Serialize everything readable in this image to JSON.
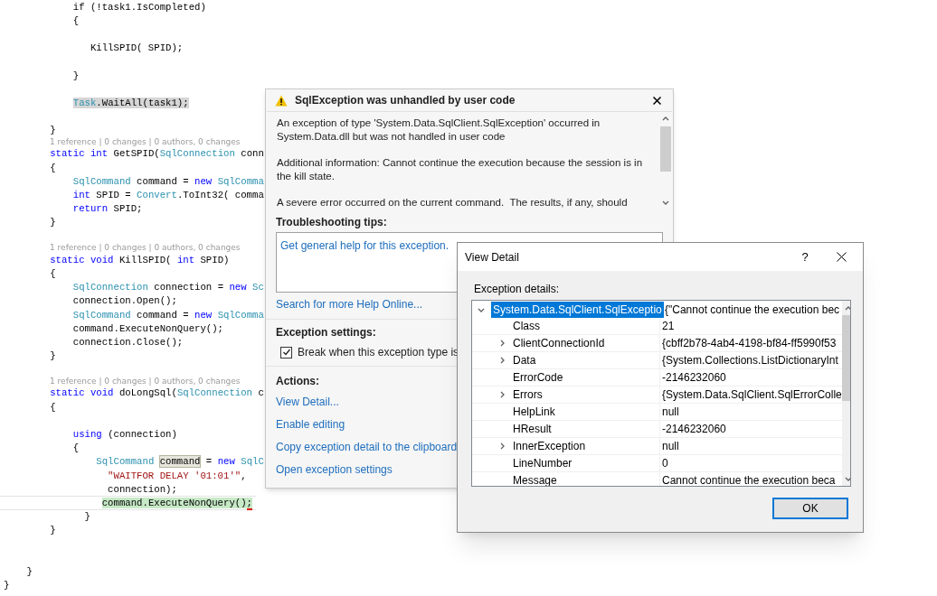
{
  "code_lines": [
    {
      "kind": "code",
      "tokens": [
        {
          "text": "            if (!task1.IsCompleted)",
          "kind": "plain"
        }
      ]
    },
    {
      "kind": "code",
      "tokens": [
        {
          "text": "            {",
          "kind": "plain"
        }
      ]
    },
    {
      "kind": "blank"
    },
    {
      "kind": "code",
      "tokens": [
        {
          "text": "               KillSPID( SPID);",
          "kind": "plain"
        }
      ]
    },
    {
      "kind": "blank"
    },
    {
      "kind": "code",
      "tokens": [
        {
          "text": "            }",
          "kind": "plain"
        }
      ]
    },
    {
      "kind": "blank"
    },
    {
      "kind": "code",
      "tokens": [
        {
          "text": "            Task",
          "kind": "type-gray"
        },
        {
          "text": ".WaitAll(task1);",
          "kind": "plain-gray"
        }
      ]
    },
    {
      "kind": "blank"
    },
    {
      "kind": "code",
      "tokens": [
        {
          "text": "        }",
          "kind": "plain"
        }
      ]
    },
    {
      "kind": "lens",
      "text": "1 reference | 0 changes | 0 authors, 0 changes"
    },
    {
      "kind": "code",
      "tokens": [
        {
          "text": "        static int ",
          "kind": "keyword"
        },
        {
          "text": "GetSPID(",
          "kind": "plain"
        },
        {
          "text": "SqlConnection",
          "kind": "type"
        },
        {
          "text": " conn",
          "kind": "plain"
        }
      ]
    },
    {
      "kind": "code",
      "tokens": [
        {
          "text": "        {",
          "kind": "plain"
        }
      ]
    },
    {
      "kind": "code",
      "tokens": [
        {
          "text": "            SqlCommand",
          "kind": "type"
        },
        {
          "text": " command = ",
          "kind": "plain"
        },
        {
          "text": "new ",
          "kind": "keyword"
        },
        {
          "text": "SqlComma",
          "kind": "type"
        }
      ]
    },
    {
      "kind": "code",
      "tokens": [
        {
          "text": "            int",
          "kind": "keyword"
        },
        {
          "text": " SPID = ",
          "kind": "plain"
        },
        {
          "text": "Convert",
          "kind": "type"
        },
        {
          "text": ".ToInt32( comma",
          "kind": "plain"
        }
      ]
    },
    {
      "kind": "code",
      "tokens": [
        {
          "text": "            return",
          "kind": "keyword"
        },
        {
          "text": " SPID;",
          "kind": "plain"
        }
      ]
    },
    {
      "kind": "code",
      "tokens": [
        {
          "text": "        }",
          "kind": "plain"
        }
      ]
    },
    {
      "kind": "blank"
    },
    {
      "kind": "lens",
      "text": "1 reference | 0 changes | 0 authors, 0 changes"
    },
    {
      "kind": "code",
      "tokens": [
        {
          "text": "        static void ",
          "kind": "keyword"
        },
        {
          "text": "KillSPID( ",
          "kind": "plain"
        },
        {
          "text": "int",
          "kind": "keyword"
        },
        {
          "text": " SPID)",
          "kind": "plain"
        }
      ]
    },
    {
      "kind": "code",
      "tokens": [
        {
          "text": "        {",
          "kind": "plain"
        }
      ]
    },
    {
      "kind": "code",
      "tokens": [
        {
          "text": "            SqlConnection",
          "kind": "type"
        },
        {
          "text": " connection = ",
          "kind": "plain"
        },
        {
          "text": "new ",
          "kind": "keyword"
        },
        {
          "text": "Sc",
          "kind": "type"
        }
      ]
    },
    {
      "kind": "code",
      "tokens": [
        {
          "text": "            connection.Open();",
          "kind": "plain"
        }
      ]
    },
    {
      "kind": "code",
      "tokens": [
        {
          "text": "            SqlCommand",
          "kind": "type"
        },
        {
          "text": " command = ",
          "kind": "plain"
        },
        {
          "text": "new ",
          "kind": "keyword"
        },
        {
          "text": "SqlComma",
          "kind": "type"
        }
      ]
    },
    {
      "kind": "code",
      "tokens": [
        {
          "text": "            command.ExecuteNonQuery();",
          "kind": "plain"
        }
      ]
    },
    {
      "kind": "code",
      "tokens": [
        {
          "text": "            connection.Close();",
          "kind": "plain"
        }
      ]
    },
    {
      "kind": "code",
      "tokens": [
        {
          "text": "        }",
          "kind": "plain"
        }
      ]
    },
    {
      "kind": "blank"
    },
    {
      "kind": "lens",
      "text": "1 reference | 0 changes | 0 authors, 0 changes"
    },
    {
      "kind": "code",
      "tokens": [
        {
          "text": "        static void ",
          "kind": "keyword"
        },
        {
          "text": "doLongSql(",
          "kind": "plain"
        },
        {
          "text": "SqlConnection",
          "kind": "type"
        },
        {
          "text": " c",
          "kind": "plain"
        }
      ]
    },
    {
      "kind": "code",
      "tokens": [
        {
          "text": "        {",
          "kind": "plain"
        }
      ]
    },
    {
      "kind": "blank"
    },
    {
      "kind": "code",
      "tokens": [
        {
          "text": "            using",
          "kind": "keyword"
        },
        {
          "text": " (connection)",
          "kind": "plain"
        }
      ]
    },
    {
      "kind": "code",
      "tokens": [
        {
          "text": "            {",
          "kind": "plain"
        }
      ]
    },
    {
      "kind": "code",
      "tokens": [
        {
          "text": "                SqlCommand",
          "kind": "type"
        },
        {
          "text": " command",
          "kind": "plain-word"
        },
        {
          "text": " = ",
          "kind": "plain"
        },
        {
          "text": "new ",
          "kind": "keyword"
        },
        {
          "text": "SqlC",
          "kind": "type"
        }
      ]
    },
    {
      "kind": "code",
      "tokens": [
        {
          "text": "                  \"WAITFOR DELAY '01:01'\"",
          "kind": "string"
        },
        {
          "text": ",",
          "kind": "plain"
        }
      ]
    },
    {
      "kind": "code",
      "tokens": [
        {
          "text": "                  connection);",
          "kind": "plain"
        }
      ]
    },
    {
      "kind": "code",
      "current": true,
      "tokens": [
        {
          "text": "                 command.ExecuteNonQuery()",
          "kind": "plain-green"
        },
        {
          "text": ";",
          "kind": "plain-green-error"
        }
      ]
    },
    {
      "kind": "code",
      "tokens": [
        {
          "text": "              }",
          "kind": "plain"
        }
      ]
    },
    {
      "kind": "code",
      "tokens": [
        {
          "text": "        }",
          "kind": "plain"
        }
      ]
    },
    {
      "kind": "blank"
    },
    {
      "kind": "blank"
    },
    {
      "kind": "code",
      "tokens": [
        {
          "text": "    }",
          "kind": "plain"
        }
      ]
    },
    {
      "kind": "code",
      "tokens": [
        {
          "text": "}",
          "kind": "plain"
        }
      ]
    }
  ],
  "exception_popup": {
    "title": "SqlException was unhandled by user code",
    "message": [
      "An exception of type 'System.Data.SqlClient.SqlException' occurred in System.Data.dll but was not handled in user code",
      "Additional information: Cannot continue the execution because the session is in the kill state.",
      "A severe error occurred on the current command.  The results, if any, should"
    ],
    "troubleshooting_heading": "Troubleshooting tips:",
    "tip_link": "Get general help for this exception.",
    "search_link": "Search for more Help Online...",
    "settings_heading": "Exception settings:",
    "break_checkbox": {
      "label": "Break when this exception type is",
      "checked": true
    },
    "actions_heading": "Actions:",
    "actions": [
      "View Detail...",
      "Enable editing",
      "Copy exception detail to the clipboard",
      "Open exception settings"
    ]
  },
  "view_detail": {
    "title": "View Detail",
    "help": "?",
    "label": "Exception details:",
    "root": {
      "name": "System.Data.SqlClient.SqlExceptio",
      "value": "{\"Cannot continue the execution bec",
      "expanded": true,
      "selected": true
    },
    "rows": [
      {
        "name": "Class",
        "value": "21",
        "expandable": false
      },
      {
        "name": "ClientConnectionId",
        "value": "{cbff2b78-4ab4-4198-bf84-ff5990f53",
        "expandable": true
      },
      {
        "name": "Data",
        "value": "{System.Collections.ListDictionaryInt",
        "expandable": true
      },
      {
        "name": "ErrorCode",
        "value": "-2146232060",
        "expandable": false
      },
      {
        "name": "Errors",
        "value": "{System.Data.SqlClient.SqlErrorColle",
        "expandable": true
      },
      {
        "name": "HelpLink",
        "value": "null",
        "expandable": false
      },
      {
        "name": "HResult",
        "value": "-2146232060",
        "expandable": false
      },
      {
        "name": "InnerException",
        "value": "null",
        "expandable": true
      },
      {
        "name": "LineNumber",
        "value": "0",
        "expandable": false
      },
      {
        "name": "Message",
        "value": "Cannot continue the execution beca",
        "expandable": false
      }
    ],
    "ok_button": "OK"
  }
}
